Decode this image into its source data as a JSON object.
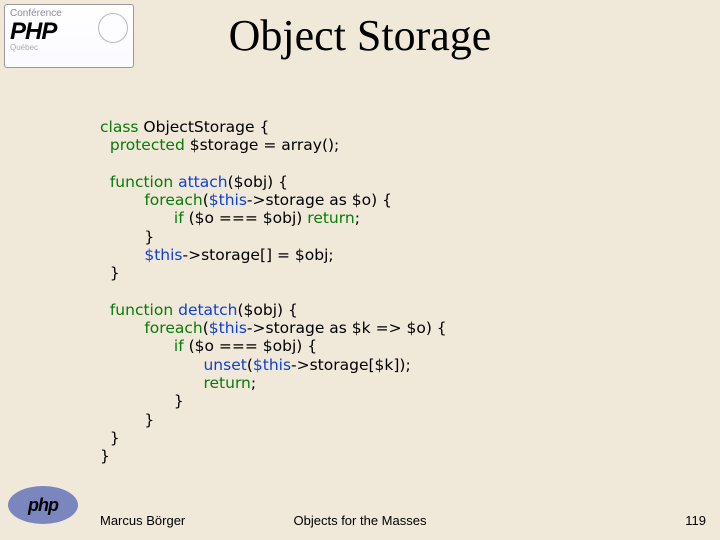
{
  "logo_top": {
    "conf": "Conférence",
    "main": "PHP",
    "sub": "Québec"
  },
  "title": "Object Storage",
  "code": {
    "l1a": "class",
    "l1b": " ObjectStorage {",
    "l2a": "  protected",
    "l2b": " $storage = array();",
    "l3": "",
    "l4a": "  function",
    "l4b": " attach",
    "l4c": "($obj) {",
    "l5a": "         foreach",
    "l5b": "(",
    "l5c": "$this",
    "l5d": "->storage as $o) {",
    "l6a": "               if",
    "l6b": " ($o === $obj) ",
    "l6c": "return",
    "l6d": ";",
    "l7": "         }",
    "l8a": "         ",
    "l8b": "$this",
    "l8c": "->storage[] = $obj;",
    "l9": "  }",
    "l10": "",
    "l11a": "  function",
    "l11b": " detatch",
    "l11c": "($obj) {",
    "l12a": "         foreach",
    "l12b": "(",
    "l12c": "$this",
    "l12d": "->storage as $k => $o) {",
    "l13a": "               if",
    "l13b": " ($o === $obj) {",
    "l14a": "                     ",
    "l14b": "unset",
    "l14c": "(",
    "l14d": "$this",
    "l14e": "->storage[$k]);",
    "l15a": "                     ",
    "l15b": "return",
    "l15c": ";",
    "l16": "               }",
    "l17": "         }",
    "l18": "  }",
    "l19": "}"
  },
  "logo_bottom": "php",
  "footer": {
    "author": "Marcus Börger",
    "center": "Objects for the Masses",
    "page": "119"
  }
}
